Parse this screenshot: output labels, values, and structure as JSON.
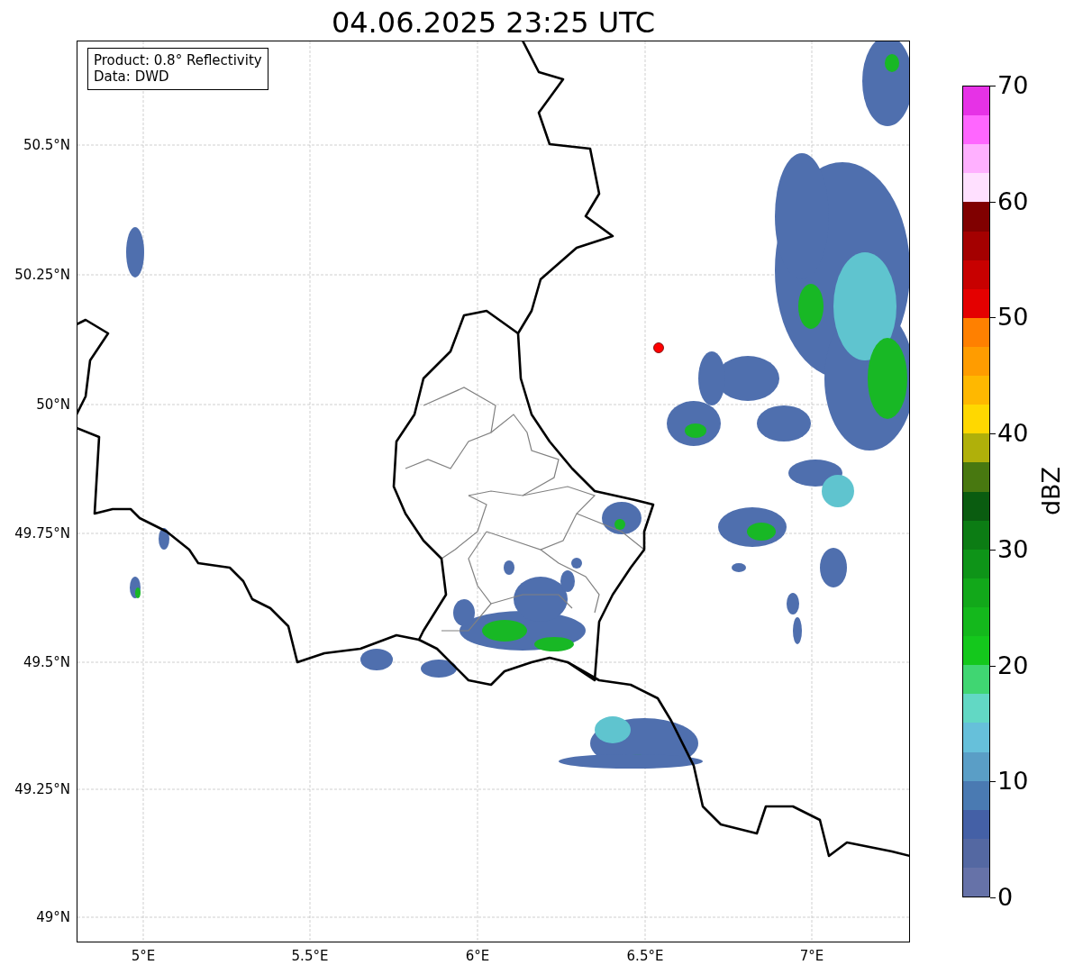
{
  "title": "04.06.2025 23:25 UTC",
  "legend": [
    "Product: 0.8° Reflectivity",
    "Data: DWD"
  ],
  "map": {
    "yticks": [
      "50.5°N",
      "50.25°N",
      "50°N",
      "49.75°N",
      "49.5°N",
      "49.25°N",
      "49°N"
    ],
    "xticks": [
      "5°E",
      "5.5°E",
      "6°E",
      "6.5°E",
      "7°E"
    ]
  },
  "colorbar": {
    "label": "dBZ",
    "ticks": [
      "70",
      "60",
      "50",
      "40",
      "30",
      "20",
      "10",
      "0"
    ],
    "bins": [
      {
        "color": "#e632e6"
      },
      {
        "color": "#ff66ff"
      },
      {
        "color": "#ffb0ff"
      },
      {
        "color": "#ffe0ff"
      },
      {
        "color": "#800000"
      },
      {
        "color": "#a40000"
      },
      {
        "color": "#c80000"
      },
      {
        "color": "#e40000"
      },
      {
        "color": "#ff8000"
      },
      {
        "color": "#ff9c00"
      },
      {
        "color": "#ffb800"
      },
      {
        "color": "#ffd800"
      },
      {
        "color": "#b0b00a"
      },
      {
        "color": "#487810"
      },
      {
        "color": "#0a5c10"
      },
      {
        "color": "#0c7c14"
      },
      {
        "color": "#0e9418"
      },
      {
        "color": "#12a81a"
      },
      {
        "color": "#14b81c"
      },
      {
        "color": "#14c81c"
      },
      {
        "color": "#40d672"
      },
      {
        "color": "#62d8c4"
      },
      {
        "color": "#66c0da"
      },
      {
        "color": "#5a9ec6"
      },
      {
        "color": "#4a7ab2"
      },
      {
        "color": "#4460a6"
      },
      {
        "color": "#5468a2"
      },
      {
        "color": "#6672a8"
      }
    ]
  }
}
